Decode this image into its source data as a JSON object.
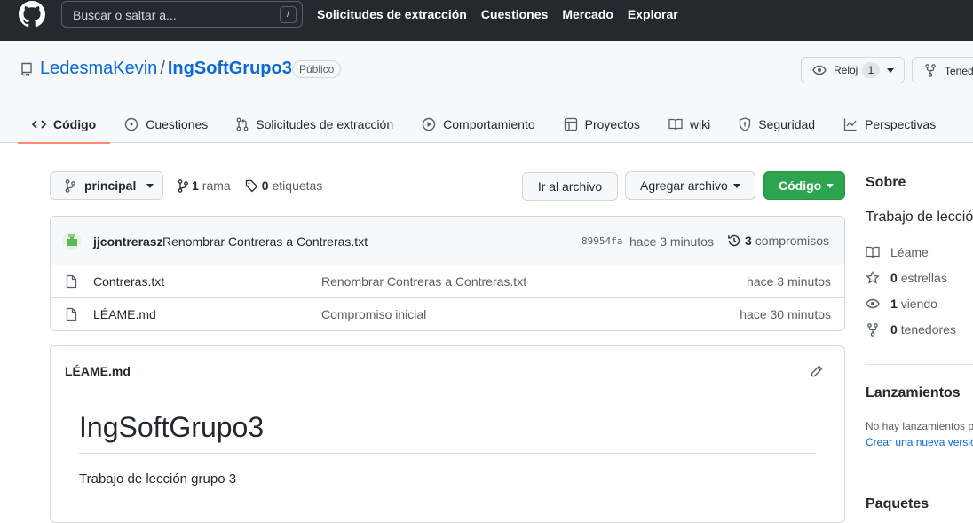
{
  "header": {
    "search_placeholder": "Buscar o saltar a...",
    "search_shortcut": "/",
    "nav": [
      "Solicitudes de extracción",
      "Cuestiones",
      "Mercado",
      "Explorar"
    ]
  },
  "repo": {
    "owner": "LedesmaKevin",
    "separator": "/",
    "name": "IngSoftGrupo3",
    "visibility": "Público",
    "watch_label": "Reloj",
    "watch_count": "1",
    "fork_label": "Tened"
  },
  "tabs": [
    {
      "label": "Código",
      "icon": "code-icon"
    },
    {
      "label": "Cuestiones",
      "icon": "issue-icon"
    },
    {
      "label": "Solicitudes de extracción",
      "icon": "pull-request-icon"
    },
    {
      "label": "Comportamiento",
      "icon": "play-icon"
    },
    {
      "label": "Proyectos",
      "icon": "table-icon"
    },
    {
      "label": "wiki",
      "icon": "book-icon"
    },
    {
      "label": "Seguridad",
      "icon": "shield-icon"
    },
    {
      "label": "Perspectivas",
      "icon": "graph-icon"
    }
  ],
  "toolbar": {
    "branch": "principal",
    "branch_count": "1",
    "branch_label": "rama",
    "tag_count": "0",
    "tag_label": "etiquetas",
    "goto_file": "Ir al archivo",
    "add_file": "Agregar archivo",
    "code": "Código"
  },
  "commit": {
    "author": "jjcontrerasz",
    "message": "Renombrar Contreras a Contreras.txt",
    "sha": "89954fa",
    "time": "hace 3 minutos",
    "count": "3",
    "count_label": "compromisos"
  },
  "files": [
    {
      "name": "Contreras.txt",
      "message": "Renombrar Contreras a Contreras.txt",
      "time": "hace 3 minutos"
    },
    {
      "name": "LÉAME.md",
      "message": "Compromiso inicial",
      "time": "hace 30 minutos"
    }
  ],
  "readme": {
    "filename": "LÉAME.md",
    "title": "IngSoftGrupo3",
    "body": "Trabajo de lección grupo 3"
  },
  "sidebar": {
    "about_heading": "Sobre",
    "description": "Trabajo de lección",
    "readme_label": "Léame",
    "stars_count": "0",
    "stars_label": "estrellas",
    "watching_count": "1",
    "watching_label": "viendo",
    "forks_count": "0",
    "forks_label": "tenedores",
    "releases_heading": "Lanzamientos",
    "no_releases": "No hay lanzamientos p",
    "create_release": "Crear una nueva versió",
    "packages_heading": "Paquetes"
  },
  "colors": {
    "header_bg": "#24292f",
    "link": "#0969da",
    "primary_button": "#2da44e",
    "active_tab_underline": "#fd8c73"
  }
}
